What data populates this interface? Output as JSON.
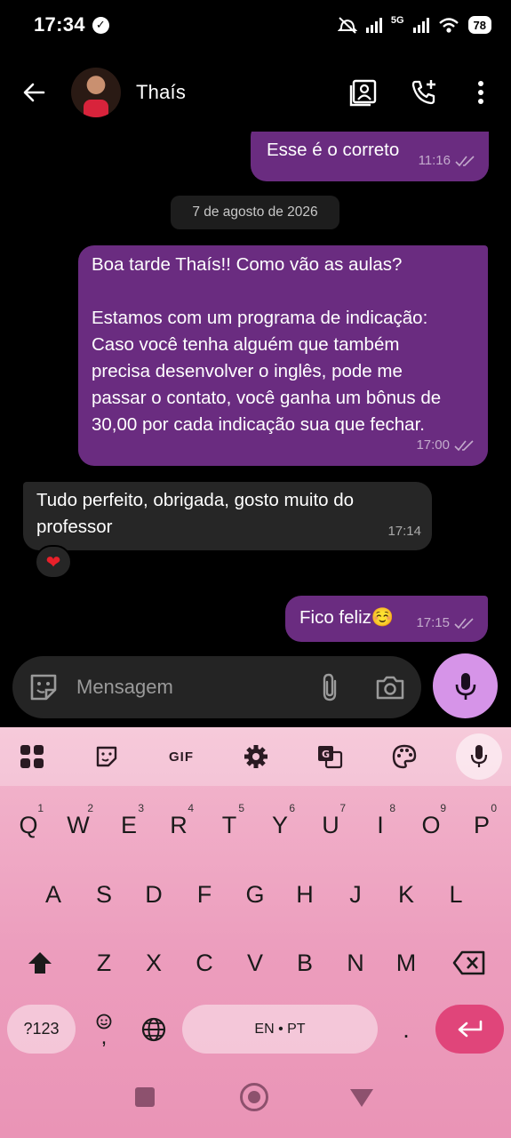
{
  "status": {
    "time": "17:34",
    "network": "5G",
    "battery": "78"
  },
  "header": {
    "contact_name": "Thaís"
  },
  "messages": [
    {
      "type": "outgoing",
      "text": "Esse é o correto",
      "time": "11:16"
    },
    {
      "type": "date",
      "text": "7 de agosto de 2026"
    },
    {
      "type": "outgoing",
      "lines": [
        "Boa tarde Thaís!! Como vão as aulas?",
        "",
        "Estamos com um programa de indicação:",
        "Caso você tenha alguém que também",
        "precisa desenvolver o inglês, pode me",
        "passar o contato, você ganha um bônus de",
        "30,00 por cada indicação sua que fechar."
      ],
      "time": "17:00"
    },
    {
      "type": "incoming",
      "lines": [
        "Tudo perfeito, obrigada, gosto muito do",
        "professor"
      ],
      "time": "17:14",
      "reaction": "heart"
    },
    {
      "type": "outgoing",
      "text": "Fico feliz☺️",
      "time": "17:15"
    }
  ],
  "composer": {
    "placeholder": "Mensagem"
  },
  "keyboard": {
    "toolbar": {
      "gif": "GIF"
    },
    "row1": [
      [
        "Q",
        "1"
      ],
      [
        "W",
        "2"
      ],
      [
        "E",
        "3"
      ],
      [
        "R",
        "4"
      ],
      [
        "T",
        "5"
      ],
      [
        "Y",
        "6"
      ],
      [
        "U",
        "7"
      ],
      [
        "I",
        "8"
      ],
      [
        "O",
        "9"
      ],
      [
        "P",
        "0"
      ]
    ],
    "row2": [
      "A",
      "S",
      "D",
      "F",
      "G",
      "H",
      "J",
      "K",
      "L"
    ],
    "row3": [
      "Z",
      "X",
      "C",
      "V",
      "B",
      "N",
      "M"
    ],
    "symbols_label": "?123",
    "comma": ",",
    "space_label": "EN • PT",
    "period": "."
  },
  "colors": {
    "outgoing_bubble": "#6a2c80",
    "incoming_bubble": "#262626",
    "mic_fab": "#d694e8",
    "enter_key": "#e0457a"
  }
}
